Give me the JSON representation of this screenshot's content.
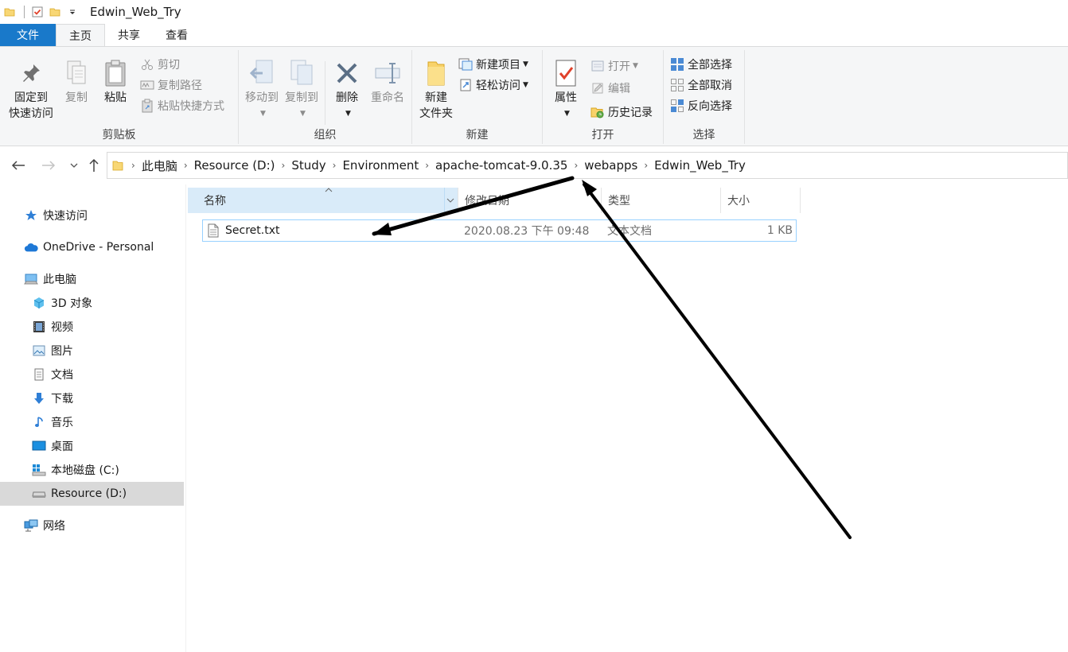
{
  "window": {
    "title": "Edwin_Web_Try"
  },
  "ribbon": {
    "tabs": [
      "文件",
      "主页",
      "共享",
      "查看"
    ],
    "groups": {
      "clipboard": {
        "label": "剪贴板",
        "pin": [
          "固定到",
          "快速访问"
        ],
        "copy": "复制",
        "paste": "粘贴",
        "cut": "剪切",
        "copy_path": "复制路径",
        "paste_shortcut": "粘贴快捷方式"
      },
      "organize": {
        "label": "组织",
        "move_to": "移动到",
        "copy_to": "复制到",
        "delete": "删除",
        "rename": "重命名"
      },
      "new": {
        "label": "新建",
        "new_folder": [
          "新建",
          "文件夹"
        ],
        "new_item": "新建项目",
        "easy_access": "轻松访问"
      },
      "open": {
        "label": "打开",
        "properties": "属性",
        "open": "打开",
        "edit": "编辑",
        "history": "历史记录"
      },
      "select": {
        "label": "选择",
        "select_all": "全部选择",
        "select_none": "全部取消",
        "invert": "反向选择"
      }
    }
  },
  "address": {
    "crumbs": [
      "此电脑",
      "Resource (D:)",
      "Study",
      "Environment",
      "apache-tomcat-9.0.35",
      "webapps",
      "Edwin_Web_Try"
    ]
  },
  "navpane": {
    "items": [
      {
        "label": "快速访问",
        "icon": "star-icon"
      },
      {
        "label": "OneDrive - Personal",
        "icon": "cloud-icon"
      },
      {
        "label": "此电脑",
        "icon": "computer-icon"
      },
      {
        "label": "3D 对象",
        "icon": "cube-icon"
      },
      {
        "label": "视频",
        "icon": "film-icon"
      },
      {
        "label": "图片",
        "icon": "picture-icon"
      },
      {
        "label": "文档",
        "icon": "document-icon"
      },
      {
        "label": "下载",
        "icon": "download-icon"
      },
      {
        "label": "音乐",
        "icon": "music-icon"
      },
      {
        "label": "桌面",
        "icon": "desktop-icon"
      },
      {
        "label": "本地磁盘 (C:)",
        "icon": "windows-drive-icon"
      },
      {
        "label": "Resource (D:)",
        "icon": "drive-icon"
      },
      {
        "label": "网络",
        "icon": "network-icon"
      }
    ],
    "selected": "Resource (D:)"
  },
  "filelist": {
    "columns": [
      "名称",
      "修改日期",
      "类型",
      "大小"
    ],
    "rows": [
      {
        "name": "Secret.txt",
        "modified": "2020.08.23 下午 09:48",
        "type": "文本文档",
        "size": "1 KB"
      }
    ]
  },
  "colors": {
    "file_tab": "#1979ca",
    "ribbon_bg": "#f5f6f7",
    "sorted_header": "#d9ebf9",
    "row_border": "#99d1ff",
    "nav_selected": "#d9d9d9"
  }
}
